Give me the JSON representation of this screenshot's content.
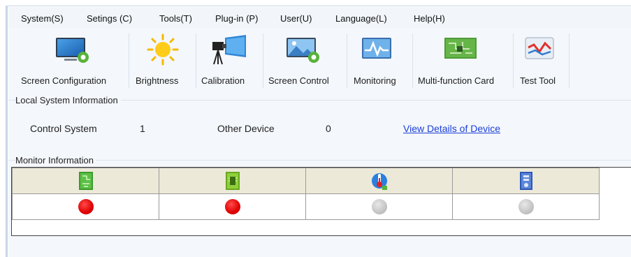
{
  "menu": {
    "items": [
      "System(S)",
      "Setings (C)",
      "Tools(T)",
      "Plug-in (P)",
      "User(U)",
      "Language(L)",
      "Help(H)"
    ]
  },
  "toolbar": {
    "items": [
      {
        "label": "Screen Configuration",
        "icon": "screen-config-icon"
      },
      {
        "label": "Brightness",
        "icon": "sun-icon"
      },
      {
        "label": "Calibration",
        "icon": "camera-icon"
      },
      {
        "label": "Screen Control",
        "icon": "screen-control-icon"
      },
      {
        "label": "Monitoring",
        "icon": "monitoring-icon"
      },
      {
        "label": "Multi-function Card",
        "icon": "circuit-card-icon"
      },
      {
        "label": "Test Tool",
        "icon": "test-tool-icon"
      }
    ]
  },
  "local_info": {
    "title": "Local System Information",
    "control_system_label": "Control System",
    "control_system_count": "1",
    "other_device_label": "Other Device",
    "other_device_count": "0",
    "details_link": "View Details of Device"
  },
  "monitor": {
    "title": "Monitor Information",
    "columns": [
      {
        "icon": "receiving-card-icon",
        "status": "red"
      },
      {
        "icon": "sending-card-icon",
        "status": "red"
      },
      {
        "icon": "thermometer-icon",
        "status": "gray"
      },
      {
        "icon": "module-icon",
        "status": "gray"
      }
    ]
  },
  "colors": {
    "link": "#1a3fd9",
    "status_error": "#e00000",
    "status_unknown": "#c4c4c4",
    "header_bg": "#ece9d8"
  }
}
